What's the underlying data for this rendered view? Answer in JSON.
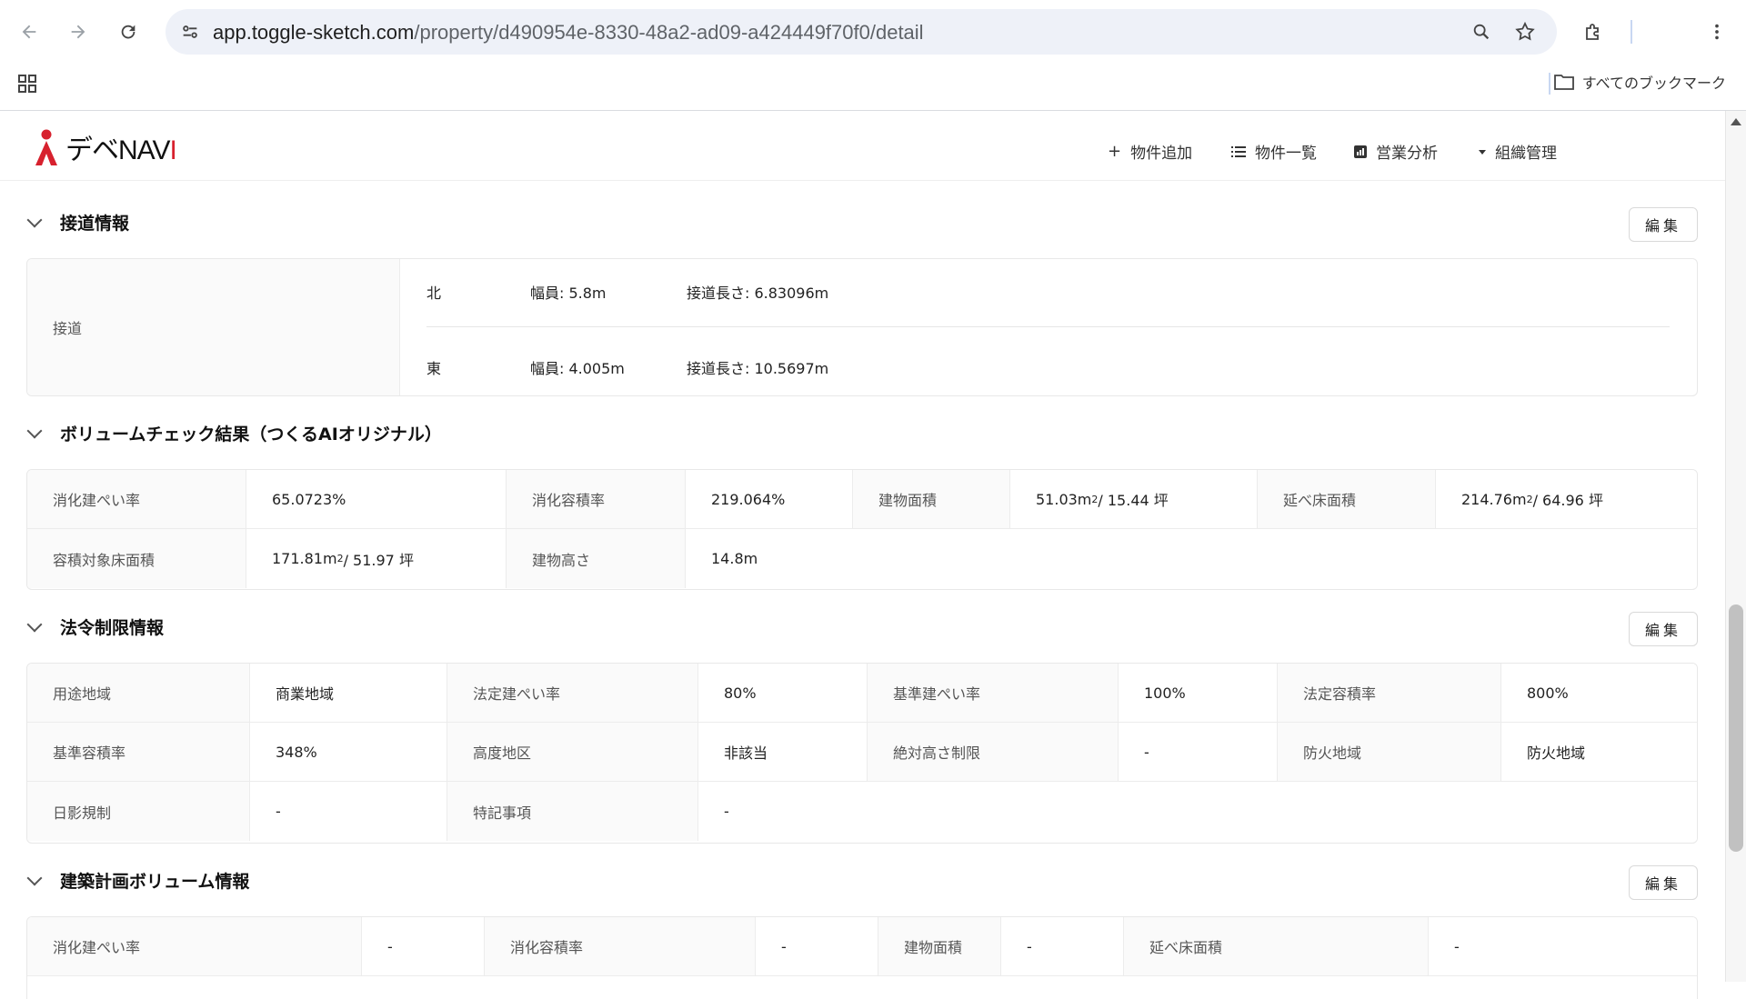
{
  "browser": {
    "url_host": "app.toggle-sketch.com",
    "url_path": "/property/d490954e-8330-48a2-ad09-a424449f70f0/detail",
    "bookmarks_all": "すべてのブックマーク"
  },
  "header": {
    "logo_text_a": "デベ",
    "logo_text_b": "NAV",
    "logo_text_c": "I",
    "menu": [
      {
        "icon": "plus-icon",
        "label": "物件追加"
      },
      {
        "icon": "list-icon",
        "label": "物件一覧"
      },
      {
        "icon": "chart-icon",
        "label": "営業分析"
      },
      {
        "icon": "caret-down-icon",
        "label": "組織管理"
      }
    ]
  },
  "edit_label": "編集",
  "road": {
    "title": "接道情報",
    "label": "接道",
    "rows": [
      {
        "direction": "北",
        "width": "幅員: 5.8m",
        "length": "接道長さ: 6.83096m"
      },
      {
        "direction": "東",
        "width": "幅員: 4.005m",
        "length": "接道長さ: 10.5697m"
      }
    ]
  },
  "volume_check": {
    "title": "ボリュームチェック結果（つくるAIオリジナル）",
    "row1": [
      {
        "label": "消化建ぺい率",
        "value": "65.0723%"
      },
      {
        "label": "消化容積率",
        "value": "219.064%"
      },
      {
        "label": "建物面積",
        "value_main": "51.03m",
        "value_sup": "2",
        "value_rest": " / 15.44 坪"
      },
      {
        "label": "延べ床面積",
        "value_main": "214.76m",
        "value_sup": "2",
        "value_rest": " / 64.96 坪"
      }
    ],
    "row2": [
      {
        "label": "容積対象床面積",
        "value_main": "171.81m",
        "value_sup": "2",
        "value_rest": " / 51.97 坪"
      },
      {
        "label": "建物高さ",
        "value": "14.8m"
      }
    ]
  },
  "legal": {
    "title": "法令制限情報",
    "rows": [
      [
        {
          "label": "用途地域",
          "value": "商業地域"
        },
        {
          "label": "法定建ぺい率",
          "value": "80%"
        },
        {
          "label": "基準建ぺい率",
          "value": "100%"
        },
        {
          "label": "法定容積率",
          "value": "800%"
        }
      ],
      [
        {
          "label": "基準容積率",
          "value": "348%"
        },
        {
          "label": "高度地区",
          "value": "非該当"
        },
        {
          "label": "絶対高さ制限",
          "value": "-"
        },
        {
          "label": "防火地域",
          "value": "防火地域"
        }
      ],
      [
        {
          "label": "日影規制",
          "value": "-"
        },
        {
          "label": "特記事項",
          "value": "-"
        }
      ]
    ]
  },
  "plan": {
    "title": "建築計画ボリューム情報",
    "row1": [
      {
        "label": "消化建ぺい率",
        "value": "-"
      },
      {
        "label": "消化容積率",
        "value": "-"
      },
      {
        "label": "建物面積",
        "value": "-"
      },
      {
        "label": "延べ床面積",
        "value": "-"
      }
    ]
  }
}
